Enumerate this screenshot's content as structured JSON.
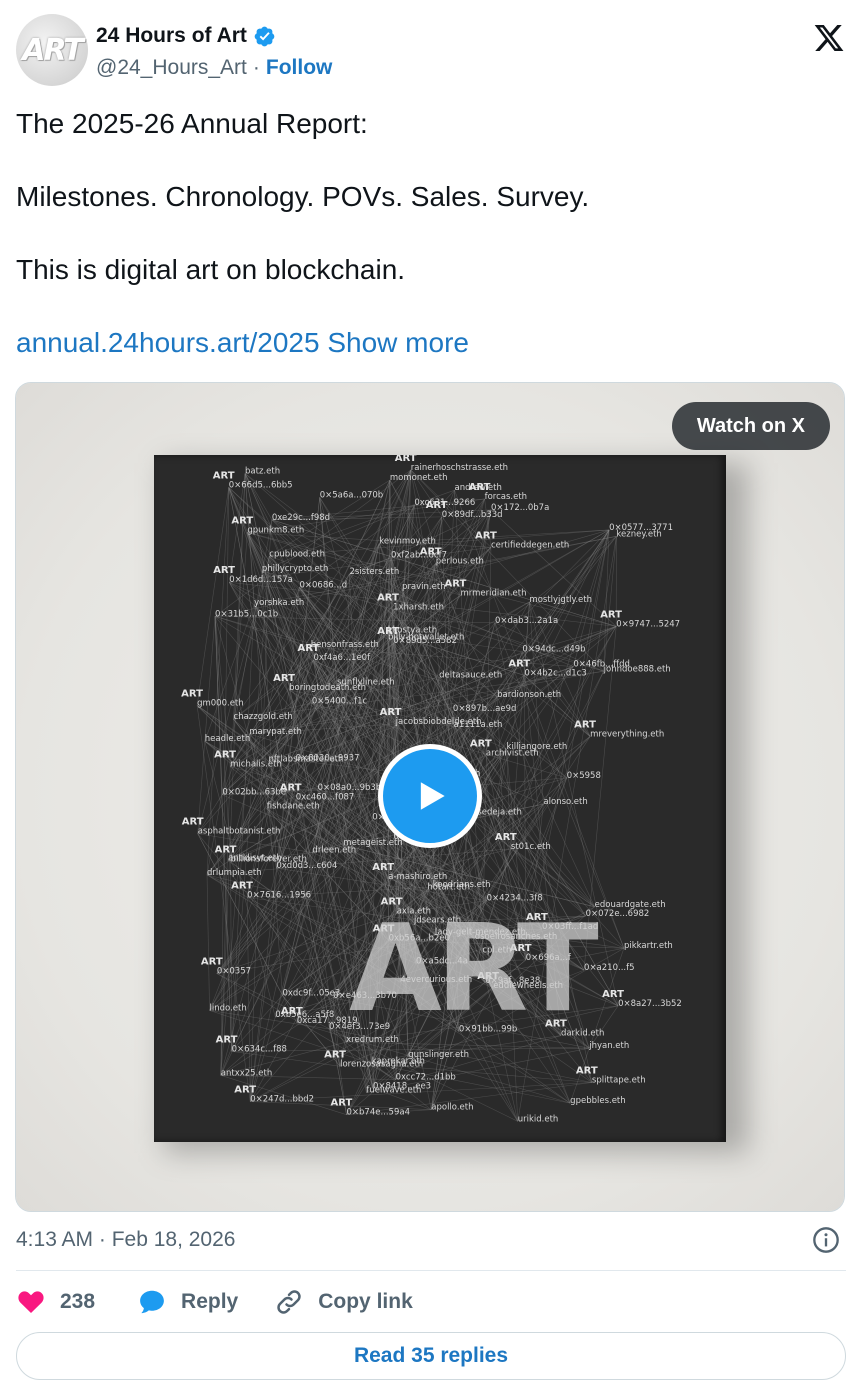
{
  "author": {
    "display_name": "24 Hours of Art",
    "handle": "@24_Hours_Art",
    "separator": "·",
    "follow_label": "Follow",
    "avatar_text": "ART"
  },
  "tweet": {
    "line1": "The 2025-26 Annual Report:",
    "line2": "Milestones. Chronology. POVs. Sales. Survey.",
    "line3": "This is digital art on blockchain.",
    "link": "annual.24hours.art/2025",
    "show_more": "Show more"
  },
  "media": {
    "watch_label": "Watch on X",
    "cover_title": "ART",
    "cover_names": [
      "rainerhoschstrasse.eth",
      "batz.eth",
      "momonet.eth",
      "0×66d5...6bb5",
      "andrew.eth",
      "0×5a6a...070b",
      "forcas.eth",
      "0xc631...9266",
      "0×172...0b7a",
      "0×89df...b33d",
      "0xe29c...f98d",
      "0×0577...3771",
      "gpunkm8.eth",
      "kezney.eth",
      "kevinmoy.eth",
      "certifieddegen.eth",
      "cpublood.eth",
      "0xf2ab...8cf7",
      "perlous.eth",
      "phillycrypto.eth",
      "2sisters.eth",
      "0×1d6d...157a",
      "0×0686...d",
      "pravin.eth",
      "mrmeridian.eth",
      "mostlyjgtly.eth",
      "yorshka.eth",
      "1xharsh.eth",
      "0×31b5...0c1b",
      "0×dab3...2a1a",
      "0×9747...5247",
      "kkostya.eth",
      "billy-hotwallet.eth",
      "0×89d5...a582",
      "bensonfrass.eth",
      "0×94dc...d49b",
      "0xf4a6...1e0f",
      "0×46fb...ffdd",
      "johndoe888.eth",
      "0×4b2c...d1c3",
      "deltasauce.eth",
      "sunflyline.eth",
      "boringtodeath.eth",
      "bardionson.eth",
      "0×5400...f1c",
      "gm000.eth",
      "0×897b...ae9d",
      "chazzgold.eth",
      "jacobsbiobdelde.eth",
      "a1111a.eth",
      "marypat.eth",
      "mreverything.eth",
      "headle.eth",
      "killiangore.eth",
      "archivist.eth",
      "0×8030...9937",
      "nftlabsmaster.eth",
      "michalis.eth",
      "thejpeg.eth",
      "0×5958",
      "luchador.eth",
      "0×08a0...9b3b",
      "0×02bb...63be",
      "0xc460...f087",
      "alonso.eth",
      "fishdane.eth",
      "josedeja.eth",
      "0×685c...9e3f",
      "deafbeef.eth",
      "asphaltbotanist.eth",
      "0×0f...3899",
      "metageist.eth",
      "st01c.eth",
      "drleen.eth",
      "antidisvt.eth",
      "billionsforever.eth",
      "0xd0d3...c604",
      "drlumpia.eth",
      "a-mashiro.eth",
      "koodrians.eth",
      "hotart.eth",
      "0×7616...1956",
      "0×4234...3f8",
      "edouardgate.eth",
      "axla.eth",
      "0×072e...6982",
      "jdsears.eth",
      "0×03ff...f1ad",
      "lady-gelt-mendez.eth",
      "dsoelrosanches.eth",
      "0xb56a...b2e0",
      "pikkartr.eth",
      "cpl.eth",
      "0×696a...f",
      "0×a5dc...4a",
      "0×a210...f5",
      "0×0357",
      "4evercurious.eth",
      "0×9af...8e38",
      "eddiewheels.eth",
      "0xdc9f...05e3",
      "0×e463...3b70",
      "0×8a27...3b52",
      "lindo.eth",
      "0xb5e6...a5f8",
      "0xca17...9819",
      "0×4ef3...73e9",
      "0×91bb...99b",
      "darkid.eth",
      "xredrum.eth",
      "jhyan.eth",
      "0×634c...f88",
      "gunslinger.eth",
      "kaprekar.eth",
      "lorenzosasagna.eth",
      "antxx25.eth",
      "0xcc72...d1bb",
      "splittape.eth",
      "0×8418...ee3",
      "fuelwave.eth",
      "0×247d...bbd2",
      "gpebbles.eth",
      "apollo.eth",
      "0×b74e...59a4",
      "urikid.eth"
    ]
  },
  "meta": {
    "timestamp": "4:13 AM · Feb 18, 2026"
  },
  "actions": {
    "like_count": "238",
    "reply_label": "Reply",
    "copy_link_label": "Copy link",
    "read_replies_label": "Read 35 replies"
  },
  "colors": {
    "link": "#1d77c2",
    "verified": "#1d9bf0",
    "like": "#f91880",
    "reply_icon": "#1d9bf0",
    "secondary_text": "#536471"
  },
  "icons": {
    "verified": "verified-badge-icon",
    "x_logo": "x-logo-icon",
    "play": "play-icon",
    "info": "info-icon",
    "heart": "heart-icon",
    "reply": "reply-bubble-icon",
    "copy_link": "link-icon"
  }
}
